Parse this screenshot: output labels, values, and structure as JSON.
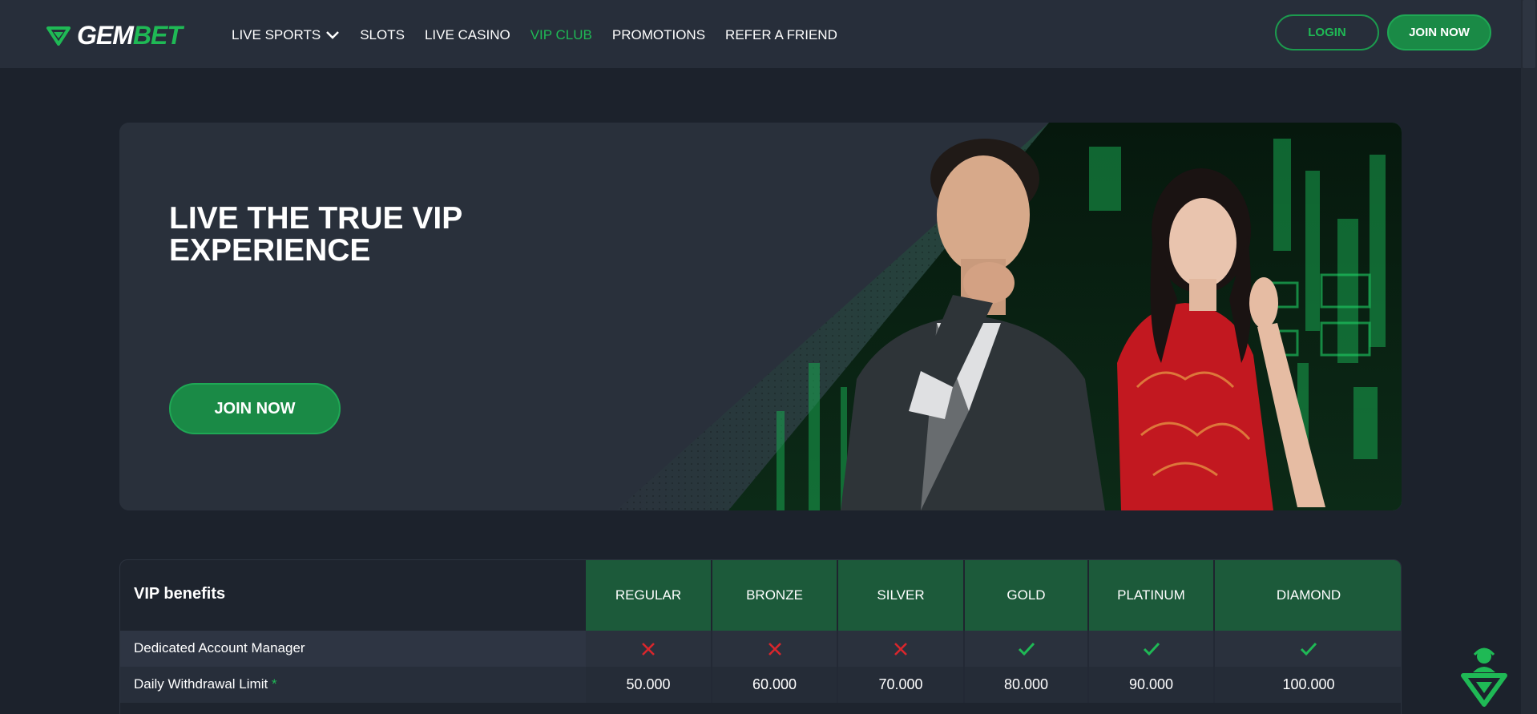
{
  "brand": {
    "name_part1": "GEM",
    "name_part2": "BET",
    "accent": "#1fb955"
  },
  "nav": {
    "items": [
      {
        "label": "LIVE SPORTS",
        "has_dropdown": true
      },
      {
        "label": "SLOTS"
      },
      {
        "label": "LIVE CASINO"
      },
      {
        "label": "VIP CLUB",
        "active": true
      },
      {
        "label": "PROMOTIONS"
      },
      {
        "label": "REFER A FRIEND"
      }
    ]
  },
  "auth": {
    "login_label": "LOGIN",
    "join_label": "JOIN NOW"
  },
  "hero": {
    "title": "LIVE THE TRUE VIP EXPERIENCE",
    "cta_label": "JOIN NOW"
  },
  "vip_table": {
    "header_title": "VIP benefits",
    "tiers": [
      "REGULAR",
      "BRONZE",
      "SILVER",
      "GOLD",
      "PLATINUM",
      "DIAMOND"
    ],
    "rows": [
      {
        "label": "Dedicated Account Manager",
        "values": [
          "cross",
          "cross",
          "cross",
          "check",
          "check",
          "check"
        ]
      },
      {
        "label": "Daily Withdrawal Limit",
        "footnote_marker": "*",
        "values": [
          "50.000",
          "60.000",
          "70.000",
          "80.000",
          "90.000",
          "100.000"
        ]
      }
    ]
  },
  "colors": {
    "check": "#1fb955",
    "cross": "#d9262c",
    "tier_header": "#1c5a3a"
  },
  "icons": {
    "support": "support-agent-icon"
  }
}
